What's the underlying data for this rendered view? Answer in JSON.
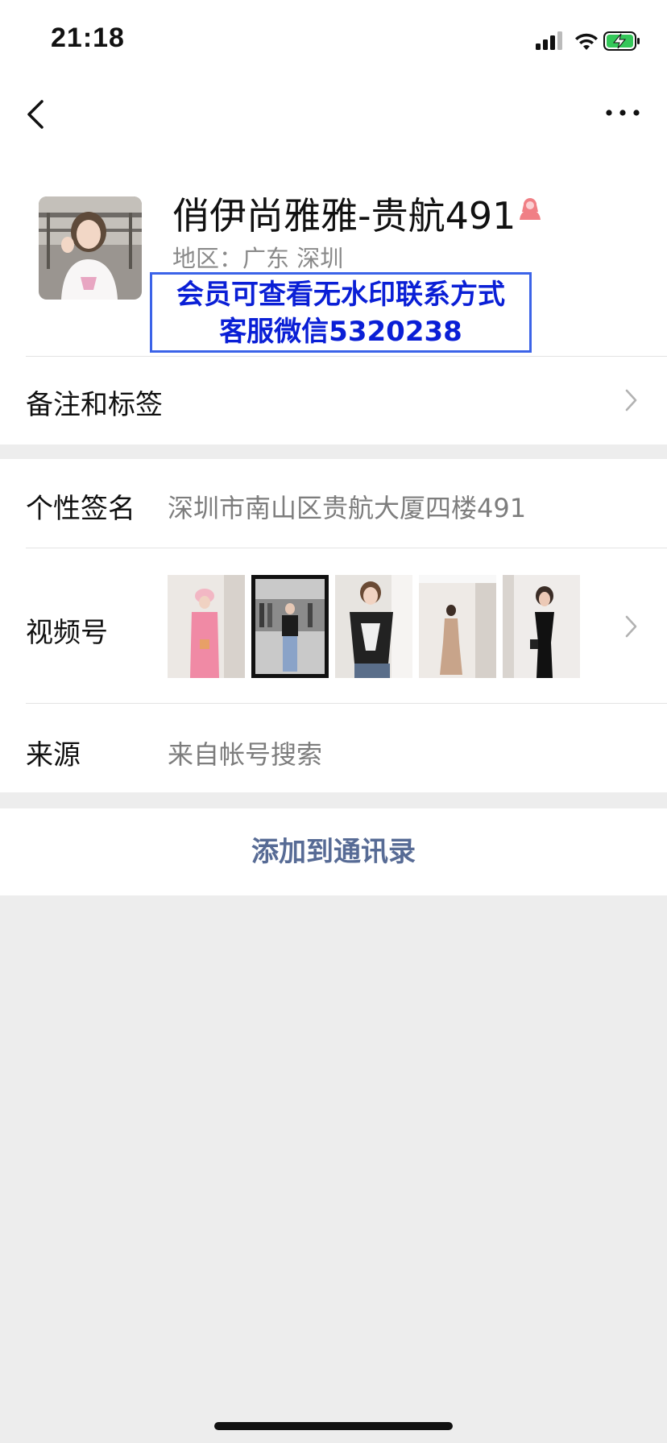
{
  "status_bar": {
    "time": "21:18",
    "icons": [
      "cellular-signal-icon",
      "wifi-icon",
      "battery-charging-icon"
    ]
  },
  "nav": {
    "back_icon": "chevron-left-icon",
    "more_icon": "more-dots-icon"
  },
  "profile": {
    "name": "俏伊尚雅雅-贵航491",
    "gender_icon": "female-person-icon",
    "region": "地区：广东 深圳"
  },
  "watermark": {
    "line1": "会员可查看无水印联系方式",
    "line2": "客服微信5320238"
  },
  "rows": {
    "remark": {
      "label": "备注和标签"
    },
    "signature": {
      "label": "个性签名",
      "value": "深圳市南山区贵航大厦四楼491"
    },
    "channels": {
      "label": "视频号",
      "thumbnails": 5
    },
    "source": {
      "label": "来源",
      "value": "来自帐号搜索"
    }
  },
  "action": {
    "add_label": "添加到通讯录"
  },
  "colors": {
    "link": "#576b95",
    "background": "#ededed",
    "watermark_text": "#0a1fd6",
    "watermark_border": "#3b63e8",
    "gender_icon": "#f07f85"
  }
}
